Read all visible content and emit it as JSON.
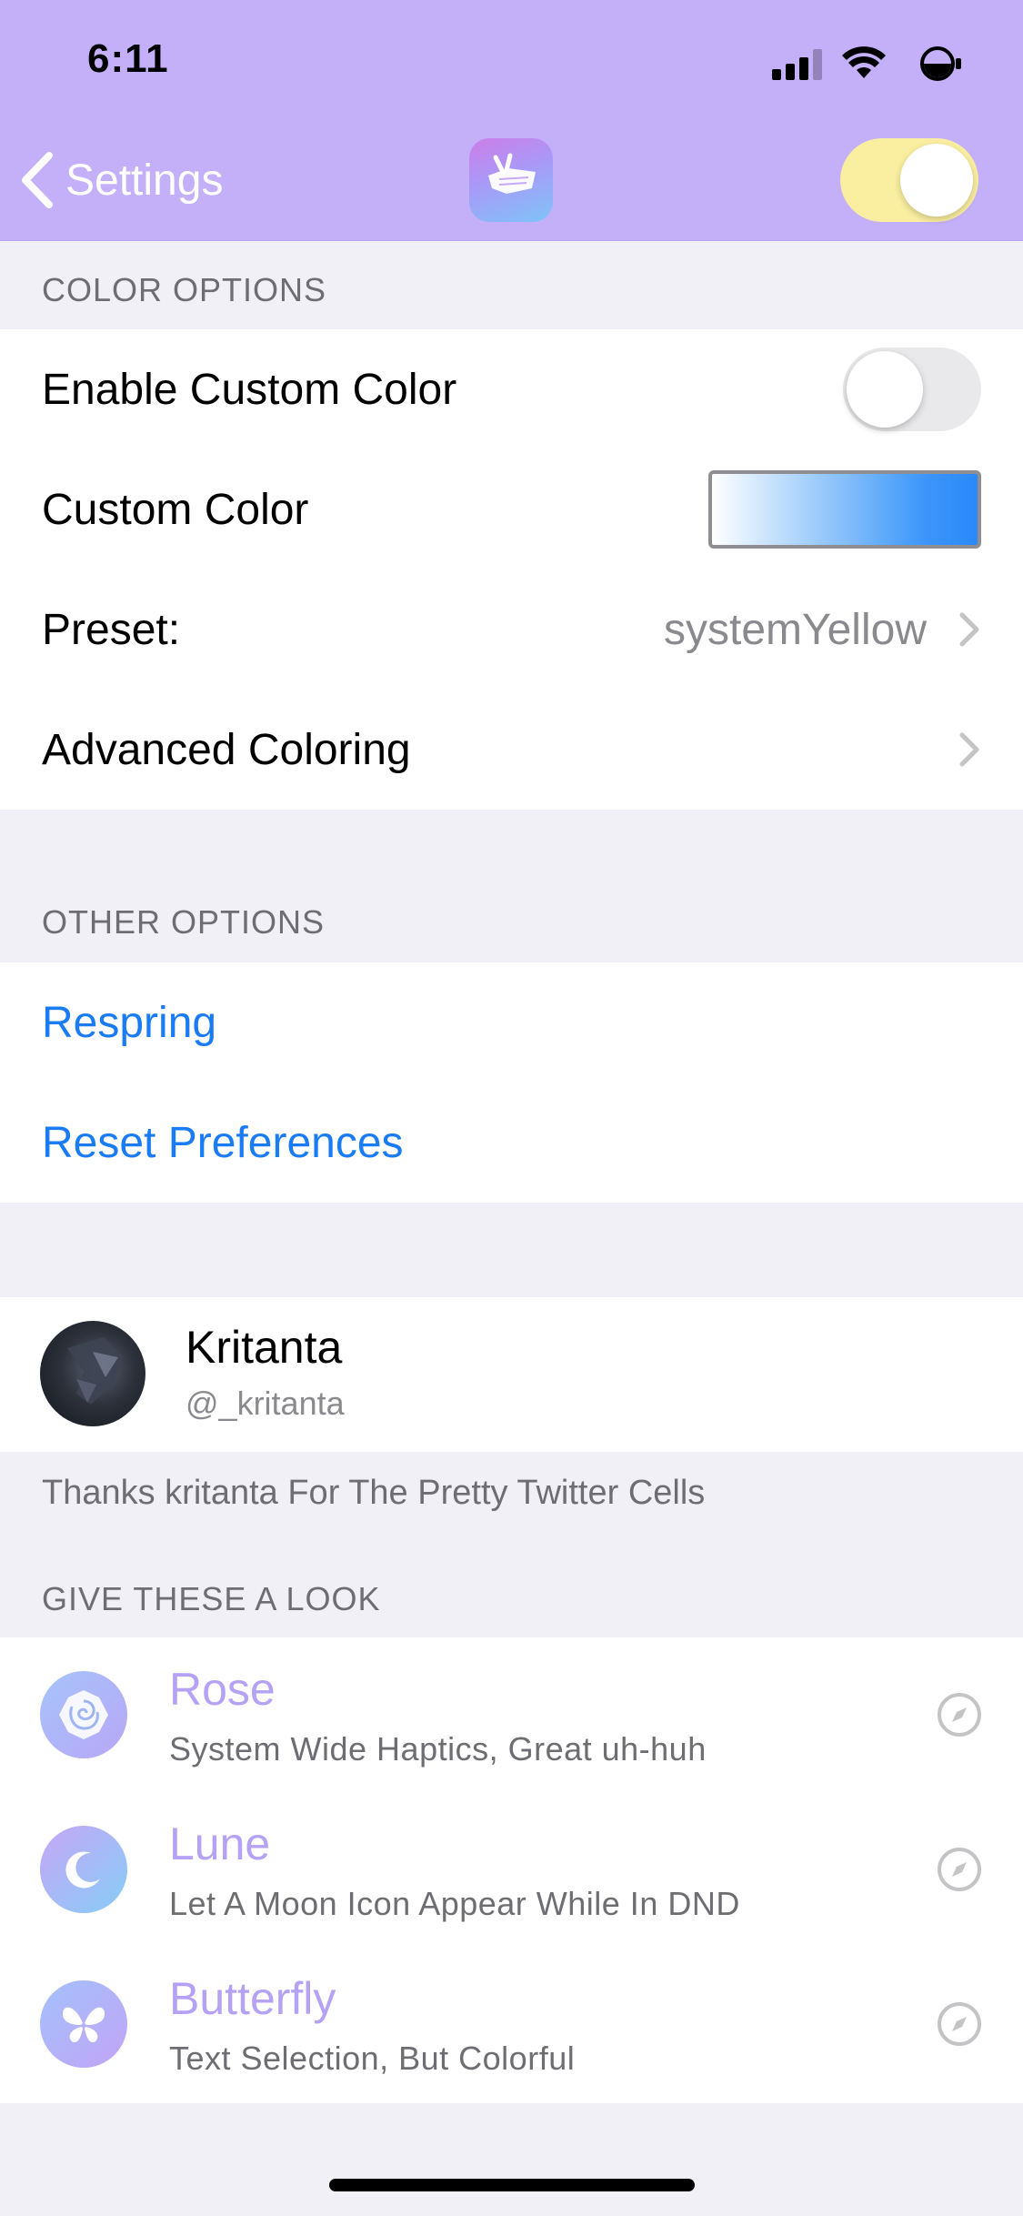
{
  "status_bar": {
    "time": "6:11"
  },
  "nav": {
    "back_label": "Settings",
    "master_toggle_on": true
  },
  "sections": {
    "color": {
      "header": "COLOR OPTIONS",
      "enable_custom_color": {
        "label": "Enable Custom Color",
        "on": false
      },
      "custom_color": {
        "label": "Custom Color"
      },
      "preset": {
        "label": "Preset:",
        "value": "systemYellow"
      },
      "advanced": {
        "label": "Advanced Coloring"
      }
    },
    "other": {
      "header": "OTHER OPTIONS",
      "respring": "Respring",
      "reset": "Reset Preferences"
    },
    "credit": {
      "name": "Kritanta",
      "handle": "@_kritanta",
      "footer": "Thanks kritanta For The Pretty Twitter Cells"
    },
    "look": {
      "header": "GIVE THESE A LOOK",
      "items": [
        {
          "title": "Rose",
          "subtitle": "System Wide Haptics, Great uh-huh",
          "icon": "rose-icon"
        },
        {
          "title": "Lune",
          "subtitle": "Let A Moon Icon Appear While In DND",
          "icon": "moon-icon"
        },
        {
          "title": "Butterfly",
          "subtitle": "Text Selection, But Colorful",
          "icon": "butterfly-icon"
        }
      ]
    }
  },
  "colors": {
    "header_bg": "#c3b0f9",
    "accent_purple": "#b5a2f4",
    "link_blue": "#1a7cf5",
    "toggle_on_yellow": "#faeea0",
    "grouped_bg": "#f1f0f6"
  }
}
